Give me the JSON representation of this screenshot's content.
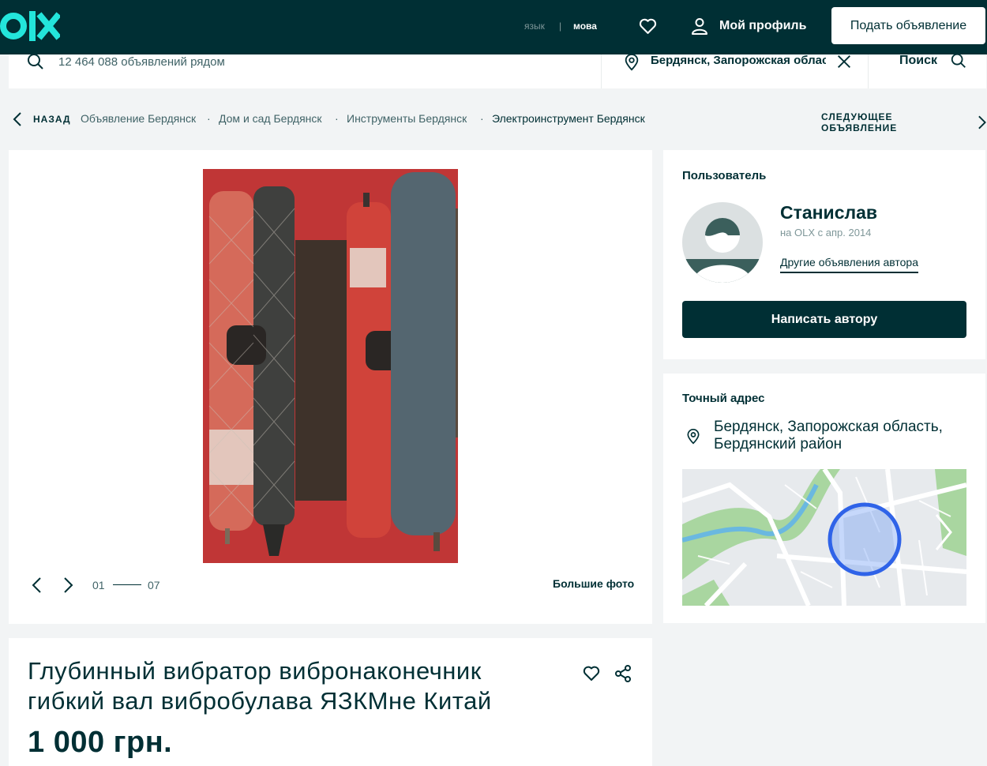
{
  "header": {
    "logo": "olx",
    "lang_ru": "язык",
    "lang_sep": "|",
    "lang_ua": "мова",
    "profile_label": "Мой профиль",
    "post_button": "Подать объявление"
  },
  "search": {
    "placeholder": "12 464 088 объявлений рядом",
    "location": "Бердянск, Запорожская область",
    "button": "Поиск"
  },
  "breadcrumb": {
    "back": "НАЗАД",
    "items": [
      "Объявление Бердянск",
      "Дом и сад Бердянск",
      "Инструменты Бердянск",
      "Электроинструмент Бердянск"
    ],
    "separator": "·",
    "next": "СЛЕДУЮЩЕЕ ОБЪЯВЛЕНИЕ"
  },
  "gallery": {
    "current": "01",
    "total": "07",
    "bigger_photo": "Большие фото"
  },
  "ad": {
    "title": "Глубинный вибратор вибронаконечник гибкий вал вибробулава ЯЗКМне Китай",
    "price": "1 000 грн."
  },
  "user": {
    "section_label": "Пользователь",
    "name": "Станислав",
    "since": "на OLX с апр. 2014",
    "other_ads": "Другие объявления автора",
    "write_button": "Написать автору"
  },
  "address": {
    "section_label": "Точный адрес",
    "line1": "Бердянск, Запорожская область,",
    "line2": "Бердянский район"
  },
  "icons": {
    "favorite": "heart-icon",
    "profile": "user-icon",
    "search": "search-icon",
    "location": "location-pin-icon",
    "clear": "close-icon",
    "share": "share-icon"
  },
  "colors": {
    "brand_dark": "#002f34",
    "brand_teal": "#23e5db",
    "background": "#f2f4f5"
  }
}
